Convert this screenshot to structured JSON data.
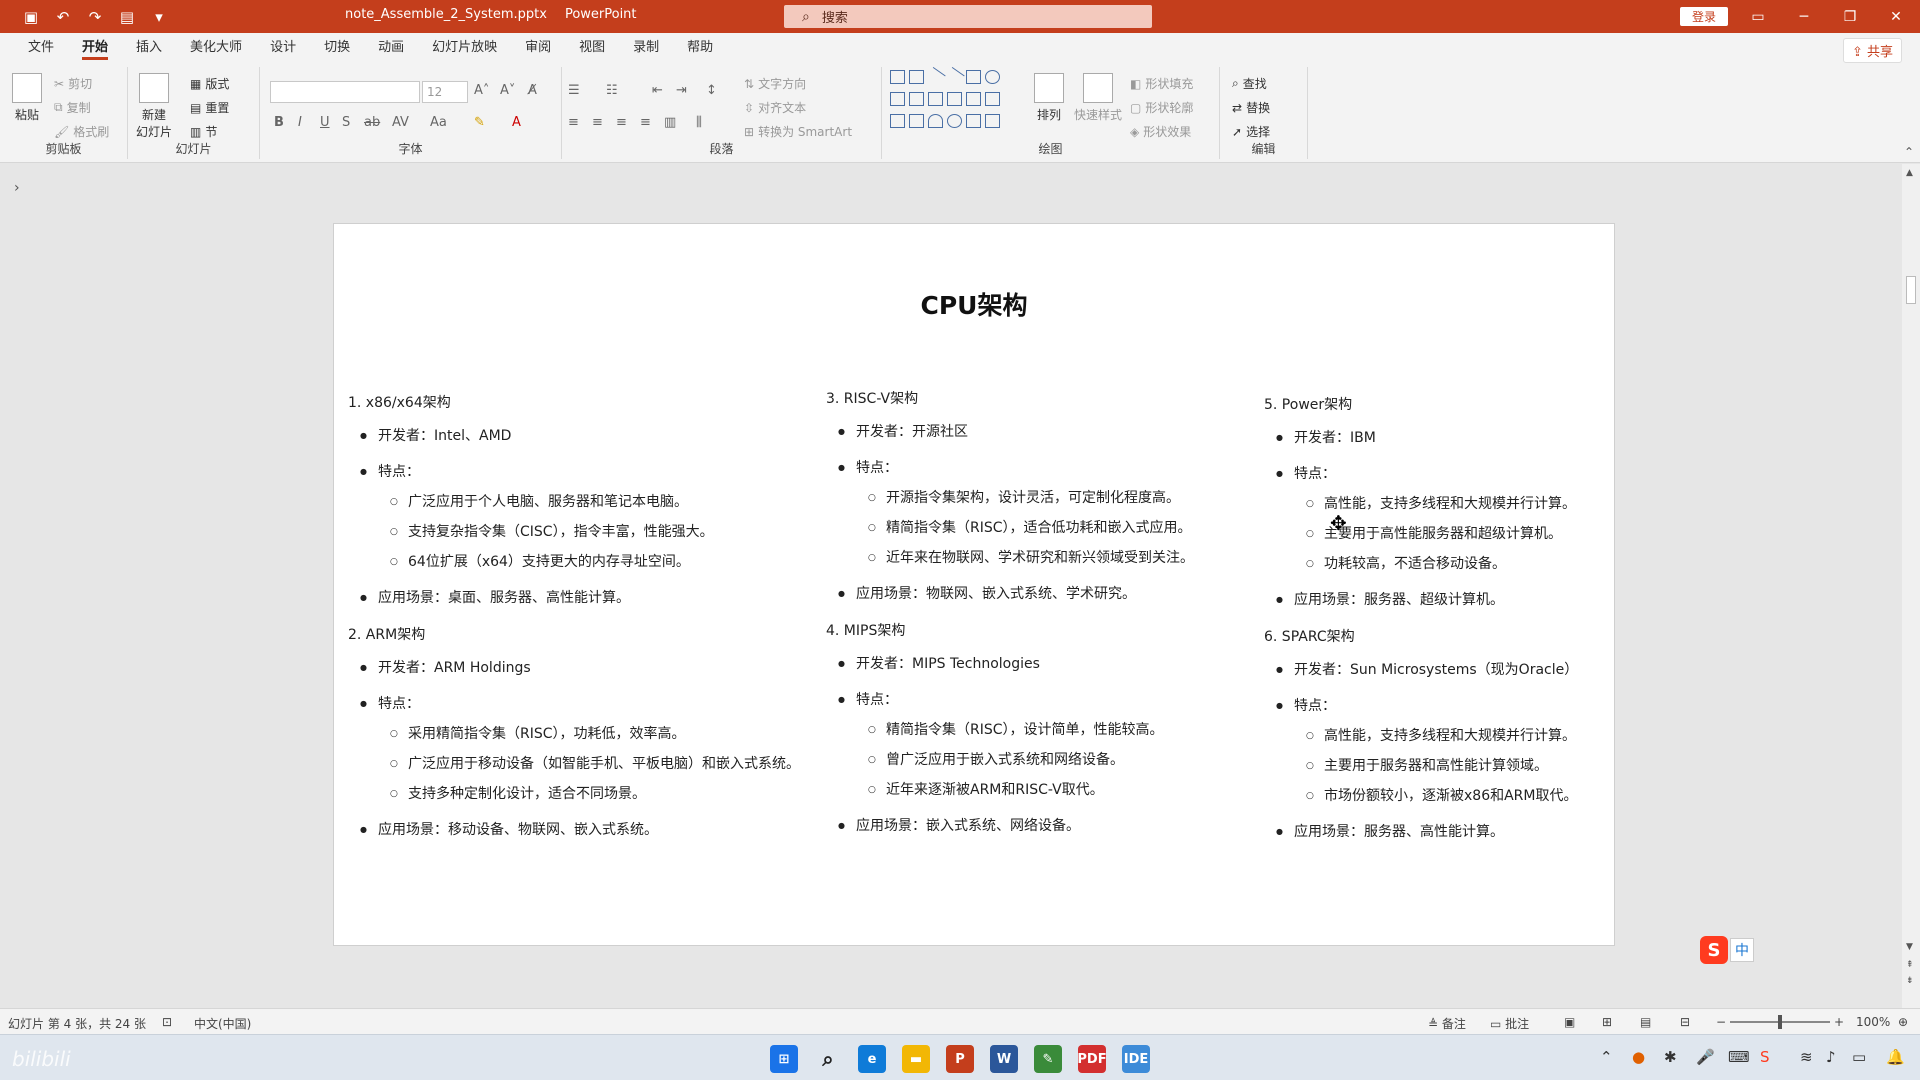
{
  "window": {
    "filename": "note_Assemble_2_System.pptx",
    "app": "PowerPoint",
    "search_placeholder": "搜索",
    "login": "登录"
  },
  "menu": [
    "文件",
    "开始",
    "插入",
    "美化大师",
    "设计",
    "切换",
    "动画",
    "幻灯片放映",
    "审阅",
    "视图",
    "录制",
    "帮助"
  ],
  "share": "共享",
  "ribbon": {
    "clipboard": {
      "label": "剪贴板",
      "paste": "粘贴",
      "cut": "剪切",
      "copy": "复制",
      "format_painter": "格式刷"
    },
    "slides": {
      "label": "幻灯片",
      "new_slide": "新建\n幻灯片",
      "layout": "版式",
      "reset": "重置",
      "section": "节"
    },
    "font": {
      "label": "字体",
      "size": "12"
    },
    "paragraph": {
      "label": "段落",
      "text_direction": "文字方向",
      "align_text": "对齐文本",
      "smartart": "转换为 SmartArt"
    },
    "drawing": {
      "label": "绘图",
      "arrange": "排列",
      "quick_styles": "快速样式",
      "shape_fill": "形状填充",
      "shape_outline": "形状轮廓",
      "shape_effects": "形状效果"
    },
    "editing": {
      "label": "编辑",
      "find": "查找",
      "replace": "替换",
      "select": "选择"
    }
  },
  "slide": {
    "title": "CPU架构",
    "columns": [
      [
        {
          "heading": "1. x86/x64架构",
          "developer": "开发者：Intel、AMD",
          "features_label": "特点：",
          "features": [
            "广泛应用于个人电脑、服务器和笔记本电脑。",
            "支持复杂指令集（CISC），指令丰富，性能强大。",
            "64位扩展（x64）支持更大的内存寻址空间。"
          ],
          "usage": "应用场景：桌面、服务器、高性能计算。"
        },
        {
          "heading": "2. ARM架构",
          "developer": "开发者：ARM Holdings",
          "features_label": "特点：",
          "features": [
            "采用精简指令集（RISC），功耗低，效率高。",
            "广泛应用于移动设备（如智能手机、平板电脑）和嵌入式系统。",
            "支持多种定制化设计，适合不同场景。"
          ],
          "usage": "应用场景：移动设备、物联网、嵌入式系统。"
        }
      ],
      [
        {
          "heading": "3. RISC-V架构",
          "developer": "开发者：开源社区",
          "features_label": "特点：",
          "features": [
            "开源指令集架构，设计灵活，可定制化程度高。",
            "精简指令集（RISC），适合低功耗和嵌入式应用。",
            "近年来在物联网、学术研究和新兴领域受到关注。"
          ],
          "usage": "应用场景：物联网、嵌入式系统、学术研究。"
        },
        {
          "heading": "4. MIPS架构",
          "developer": "开发者：MIPS Technologies",
          "features_label": "特点：",
          "features": [
            "精简指令集（RISC），设计简单，性能较高。",
            "曾广泛应用于嵌入式系统和网络设备。",
            "近年来逐渐被ARM和RISC-V取代。"
          ],
          "usage": "应用场景：嵌入式系统、网络设备。"
        }
      ],
      [
        {
          "heading": "5. Power架构",
          "developer": "开发者：IBM",
          "features_label": "特点：",
          "features": [
            "高性能，支持多线程和大规模并行计算。",
            "主要用于高性能服务器和超级计算机。",
            "功耗较高，不适合移动设备。"
          ],
          "usage": "应用场景：服务器、超级计算机。"
        },
        {
          "heading": "6. SPARC架构",
          "developer": "开发者：Sun Microsystems（现为Oracle）",
          "features_label": "特点：",
          "features": [
            "高性能，支持多线程和大规模并行计算。",
            "主要用于服务器和高性能计算领域。",
            "市场份额较小，逐渐被x86和ARM取代。"
          ],
          "usage": "应用场景：服务器、高性能计算。"
        }
      ]
    ]
  },
  "status": {
    "slide_info": "幻灯片 第 4 张，共 24 张",
    "language": "中文(中国)",
    "notes": "备注",
    "comments": "批注",
    "zoom": "100%"
  },
  "ime": {
    "mode": "中"
  },
  "colors": {
    "accent": "#c43e1c"
  }
}
